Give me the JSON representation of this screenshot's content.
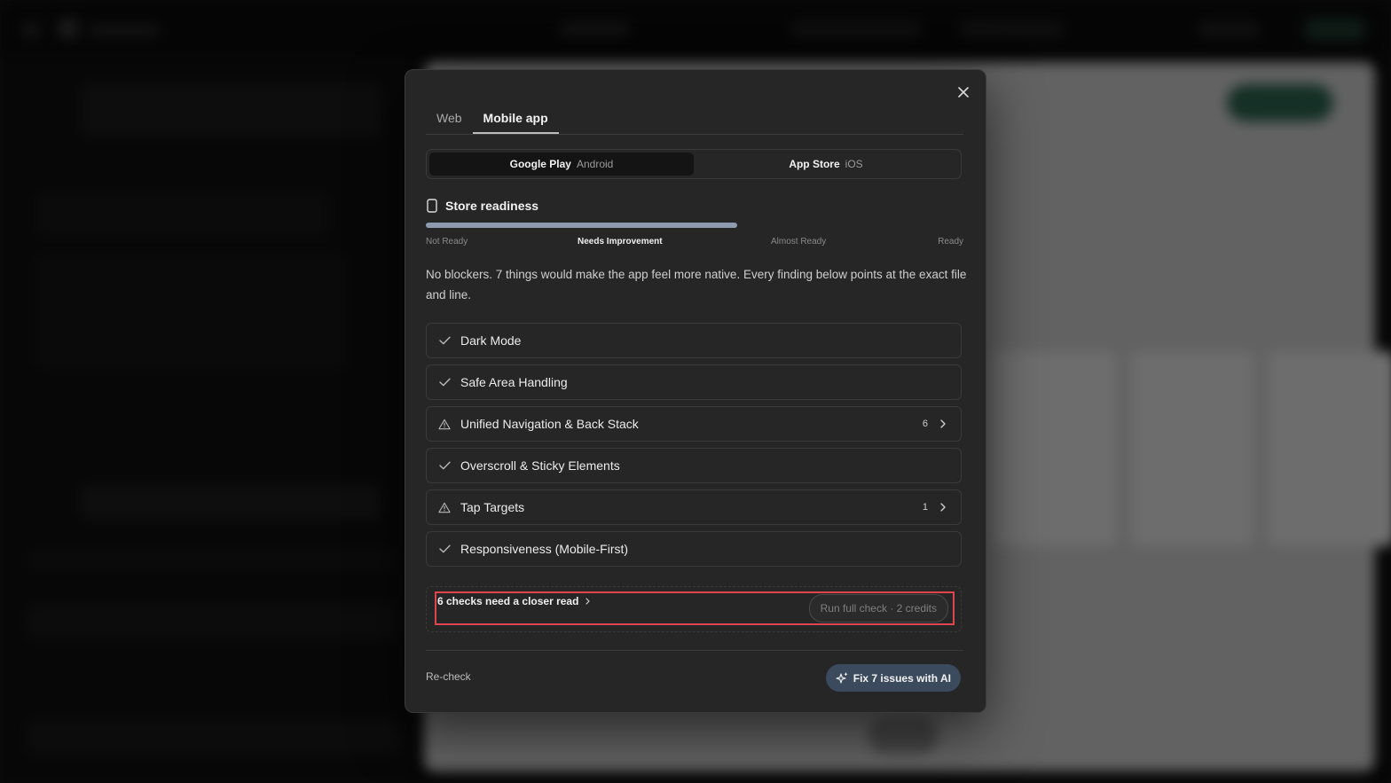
{
  "dialog": {
    "tabs": [
      {
        "label": "Web",
        "active": false
      },
      {
        "label": "Mobile app",
        "active": true
      }
    ],
    "platforms": [
      {
        "name": "Google Play",
        "os": "Android",
        "active": true
      },
      {
        "name": "App Store",
        "os": "iOS",
        "active": false
      }
    ],
    "readiness": {
      "title": "Store readiness",
      "progress_fraction": 0.58,
      "levels": [
        "Not Ready",
        "Needs Improvement",
        "Almost Ready",
        "Ready"
      ],
      "current_level": "Needs Improvement"
    },
    "summary": "No blockers. 7 things would make the app feel more native. Every finding below points at the exact file and line.",
    "checks": [
      {
        "label": "Dark Mode",
        "status": "pass",
        "count": ""
      },
      {
        "label": "Safe Area Handling",
        "status": "pass",
        "count": ""
      },
      {
        "label": "Unified Navigation & Back Stack",
        "status": "warning",
        "count": "6"
      },
      {
        "label": "Overscroll & Sticky Elements",
        "status": "pass",
        "count": ""
      },
      {
        "label": "Tap Targets",
        "status": "warning",
        "count": "1"
      },
      {
        "label": "Responsiveness (Mobile-First)",
        "status": "pass",
        "count": ""
      }
    ],
    "closer_read_label": "6 checks need a closer read",
    "run_full_check_label": "Run full check · 2 credits",
    "recheck_label": "Re-check",
    "fix_button_label": "Fix 7 issues with AI"
  },
  "colors": {
    "highlight": "#e0454f",
    "fix_button_bg": "#3b4a5c",
    "progress": "#8e9aad"
  },
  "icons": {
    "pass": "check-icon",
    "warning": "warning-triangle-icon",
    "close": "close-icon",
    "phone": "phone-icon",
    "sparkle": "sparkle-icon"
  }
}
